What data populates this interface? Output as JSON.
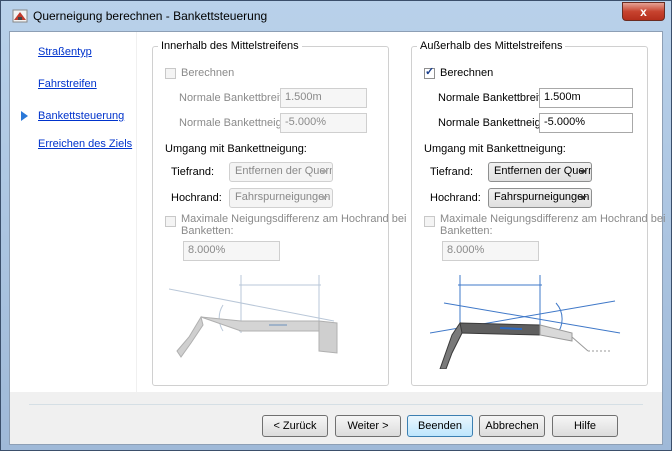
{
  "window": {
    "title": "Querneigung berechnen - Bankettsteuerung",
    "close_symbol": "x"
  },
  "nav": {
    "items": [
      {
        "label": "Straßentyp"
      },
      {
        "label": "Fahrstreifen"
      },
      {
        "label": "Bankettsteuerung",
        "active": true
      },
      {
        "label": "Erreichen des Ziels"
      }
    ]
  },
  "inside": {
    "title": "Innerhalb des Mittelstreifens",
    "calculate_label": "Berechnen",
    "calculate_checked": false,
    "enabled": false,
    "width_label": "Normale Bankettbreite:",
    "width_value": "1.500m",
    "slope_label": "Normale Bankettneigung:",
    "slope_value": "-5.000%",
    "handling_label": "Umgang mit Bankettneigung:",
    "low_label": "Tiefrand:",
    "low_value": "Entfernen der Querne",
    "high_label": "Hochrand:",
    "high_value": "Fahrspurneigungen a",
    "maxdiff_label_1": "Maximale Neigungsdifferenz am Hochrand bei",
    "maxdiff_label_2": "Banketten:",
    "maxdiff_value": "8.000%"
  },
  "outside": {
    "title": "Außerhalb des Mittelstreifens",
    "calculate_label": "Berechnen",
    "calculate_checked": true,
    "enabled": true,
    "width_label": "Normale Bankettbreite:",
    "width_value": "1.500m",
    "slope_label": "Normale Bankettneigung:",
    "slope_value": "-5.000%",
    "handling_label": "Umgang mit Bankettneigung:",
    "low_label": "Tiefrand:",
    "low_value": "Entfernen der Querne",
    "high_label": "Hochrand:",
    "high_value": "Fahrspurneigungen a",
    "maxdiff_label_1": "Maximale Neigungsdifferenz am Hochrand bei",
    "maxdiff_label_2": "Banketten:",
    "maxdiff_value": "8.000%"
  },
  "buttons": {
    "back": "< Zurück",
    "next": "Weiter >",
    "finish": "Beenden",
    "cancel": "Abbrechen",
    "help": "Hilfe"
  },
  "colors": {
    "link": "#0033cc",
    "accent": "#2b78d8",
    "close": "#c7432f"
  }
}
